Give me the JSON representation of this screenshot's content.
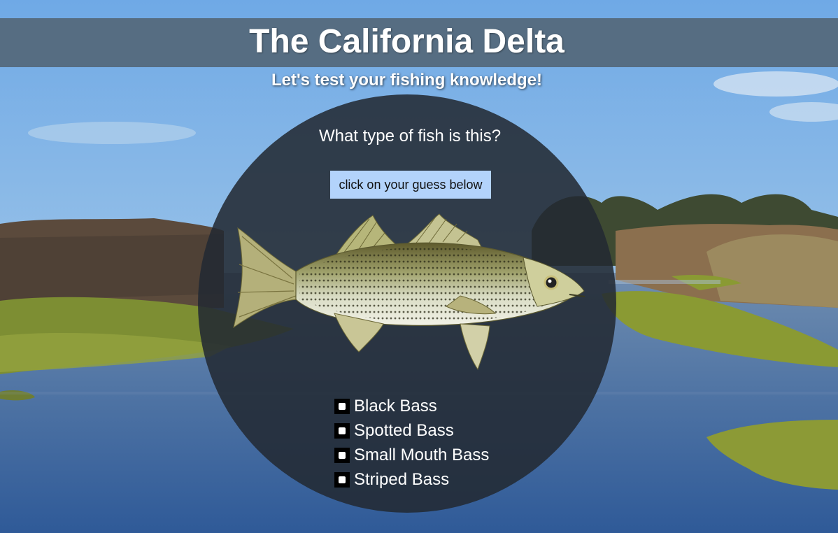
{
  "header": {
    "title": "The California Delta",
    "subtitle": "Let's test your fishing knowledge!"
  },
  "quiz": {
    "question": "What type of fish is this?",
    "hint_button": "click on your guess below",
    "answers": [
      {
        "label": "Black Bass"
      },
      {
        "label": "Spotted Bass"
      },
      {
        "label": "Small Mouth Bass"
      },
      {
        "label": "Striped Bass"
      }
    ]
  },
  "colors": {
    "title_bar": "#54687a",
    "circle": "#222933",
    "hint_button": "#b3d3fb",
    "sky": "#7db4e8",
    "water": "#4e73a2",
    "marsh": "#8a9a3a"
  }
}
